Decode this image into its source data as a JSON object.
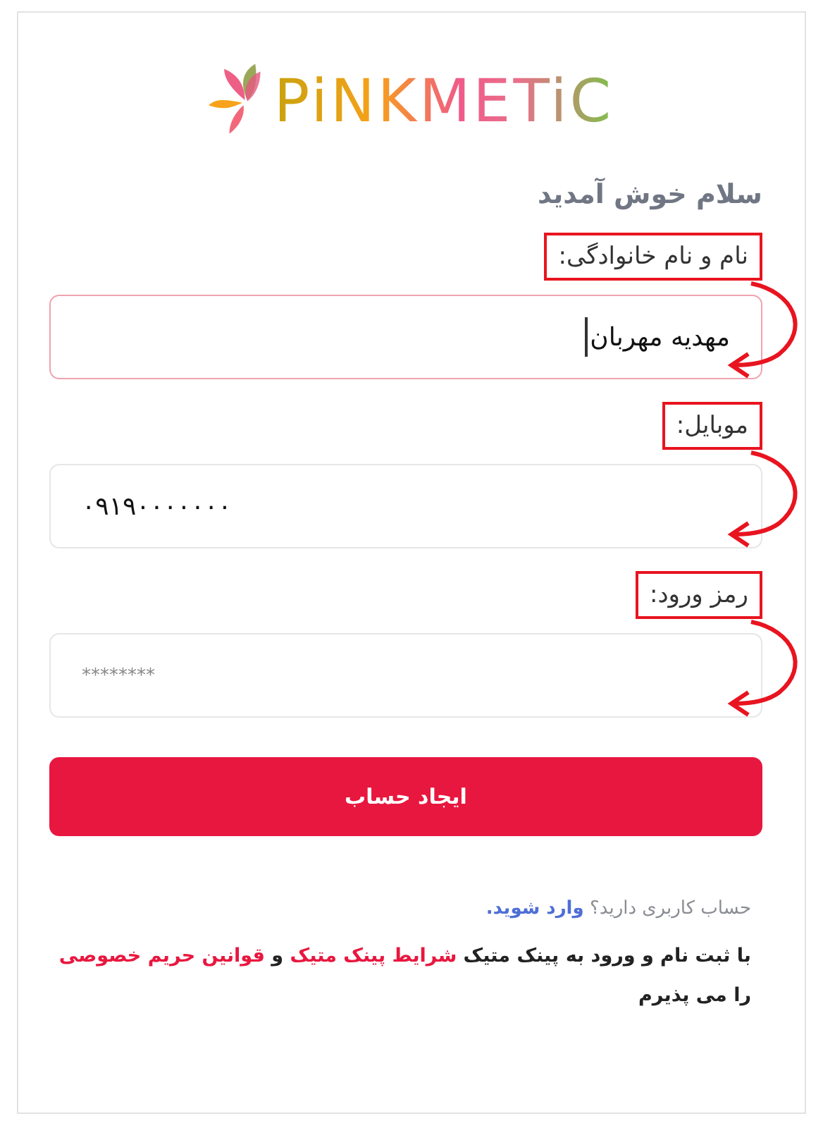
{
  "logo": {
    "text": "PiNKMETiC"
  },
  "heading": "سلام خوش آمدید",
  "fields": [
    {
      "label": "نام و نام خانوادگی:",
      "value": "مهدیه مهربان",
      "kind": "text",
      "focused": true,
      "annotated": true
    },
    {
      "label": "موبایل:",
      "value": "۰۹۱۹۰۰۰۰۰۰۰",
      "kind": "phone",
      "focused": false,
      "annotated": true
    },
    {
      "label": "رمز ورود:",
      "placeholder": "********",
      "kind": "password",
      "focused": false,
      "annotated": true
    }
  ],
  "submit": "ایجاد حساب",
  "login": {
    "text": "حساب کاربری دارید؟",
    "link": "وارد شوید."
  },
  "terms": [
    {
      "kind": "text",
      "text": "با ثبت نام و ورود به پینک متیک "
    },
    {
      "kind": "link",
      "text": "شرایط پینک متیک"
    },
    {
      "kind": "text",
      "text": " و "
    },
    {
      "kind": "link",
      "text": "قوانین حریم خصوصی"
    },
    {
      "kind": "text",
      "text": " را می پذیرم"
    }
  ]
}
